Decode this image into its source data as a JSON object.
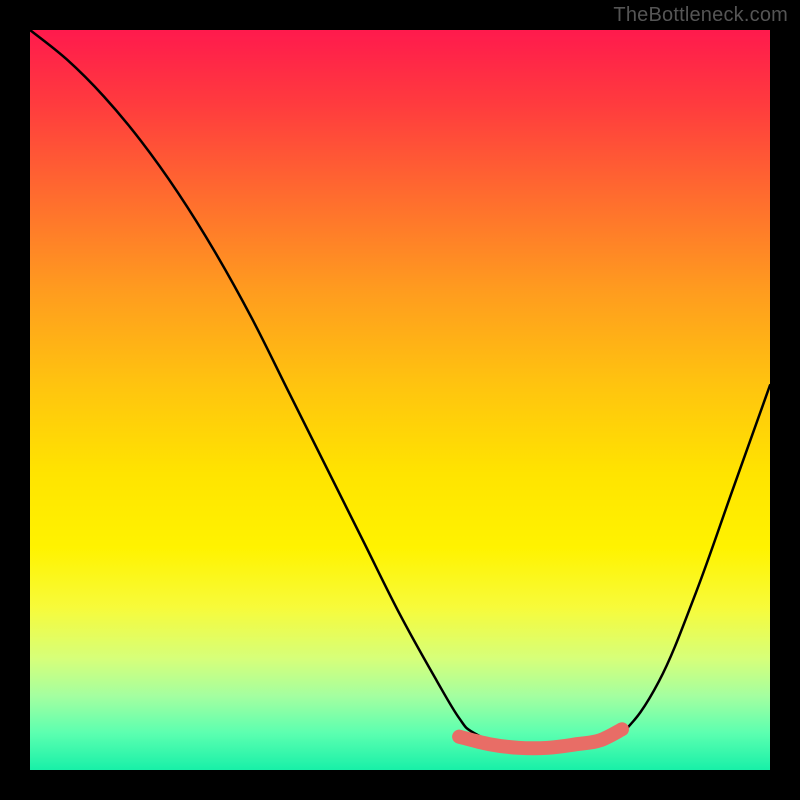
{
  "attribution": "TheBottleneck.com",
  "colors": {
    "curve": "#000000",
    "highlight": "#e86d66",
    "gradient_top": "#ff1a4d",
    "gradient_bottom": "#18f0a8",
    "background": "#000000"
  },
  "chart_data": {
    "type": "line",
    "title": "",
    "xlabel": "",
    "ylabel": "",
    "xlim": [
      0,
      100
    ],
    "ylim": [
      0,
      100
    ],
    "series": [
      {
        "name": "bottleneck-curve",
        "x": [
          0,
          5,
          10,
          15,
          20,
          25,
          30,
          35,
          40,
          45,
          50,
          55,
          58,
          60,
          65,
          70,
          75,
          80,
          85,
          90,
          95,
          100
        ],
        "values": [
          100,
          96,
          91,
          85,
          78,
          70,
          61,
          51,
          41,
          31,
          21,
          12,
          7,
          5,
          3,
          3,
          3,
          5,
          12,
          24,
          38,
          52
        ]
      },
      {
        "name": "optimal-range-highlight",
        "x": [
          58,
          62,
          66,
          70,
          74,
          77,
          80
        ],
        "values": [
          4.5,
          3.5,
          3.0,
          3.0,
          3.5,
          4.0,
          5.5
        ]
      }
    ],
    "highlight_dot": {
      "x": 58,
      "y": 4.5
    }
  }
}
